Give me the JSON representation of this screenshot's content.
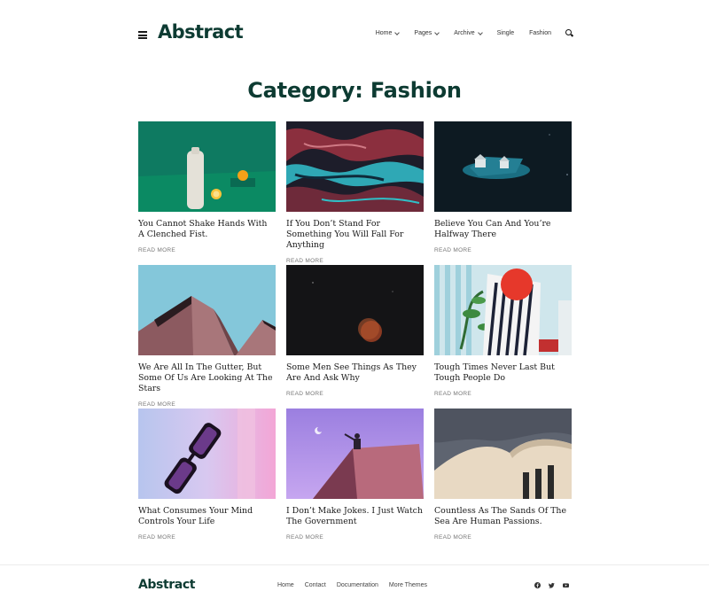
{
  "header": {
    "logo": "Abstract",
    "nav": [
      {
        "label": "Home",
        "has_dropdown": true
      },
      {
        "label": "Pages",
        "has_dropdown": true
      },
      {
        "label": "Archive",
        "has_dropdown": true
      },
      {
        "label": "Single",
        "has_dropdown": false
      },
      {
        "label": "Fashion",
        "has_dropdown": false
      }
    ]
  },
  "page": {
    "title": "Category: Fashion"
  },
  "posts": [
    {
      "title": "You Cannot Shake Hands With A Clenched Fist.",
      "read_more": "READ MORE",
      "image": "teal-bottle-lemon-image"
    },
    {
      "title": "If You Don’t Stand For Something You Will Fall For Anything",
      "read_more": "READ MORE",
      "image": "abstract-marble-image"
    },
    {
      "title": "Believe You Can And You’re Halfway There",
      "read_more": "READ MORE",
      "image": "night-house-island-image"
    },
    {
      "title": "We Are All In The Gutter, But Some Of Us Are Looking At The Stars",
      "read_more": "READ MORE",
      "image": "pink-building-sky-image"
    },
    {
      "title": "Some Men See Things As They Are And Ask Why",
      "read_more": "READ MORE",
      "image": "moon-dark-sky-image"
    },
    {
      "title": "Tough Times Never Last But Tough People Do",
      "read_more": "READ MORE",
      "image": "striped-dress-plant-image"
    },
    {
      "title": "What Consumes Your Mind Controls Your Life",
      "read_more": "READ MORE",
      "image": "sunglasses-gradient-image"
    },
    {
      "title": "I Don’t Make Jokes. I Just Watch The Government",
      "read_more": "READ MORE",
      "image": "person-rooftop-purple-image"
    },
    {
      "title": "Countless As The Sands Of The Sea Are Human Passions.",
      "read_more": "READ MORE",
      "image": "curved-building-image"
    }
  ],
  "footer": {
    "logo": "Abstract",
    "links": [
      "Home",
      "Contact",
      "Documentation",
      "More Themes"
    ],
    "social": [
      "facebook-icon",
      "twitter-icon",
      "youtube-icon"
    ]
  },
  "colors": {
    "brand": "#0d3b32",
    "text": "#1b1b1b",
    "muted": "#777777"
  }
}
